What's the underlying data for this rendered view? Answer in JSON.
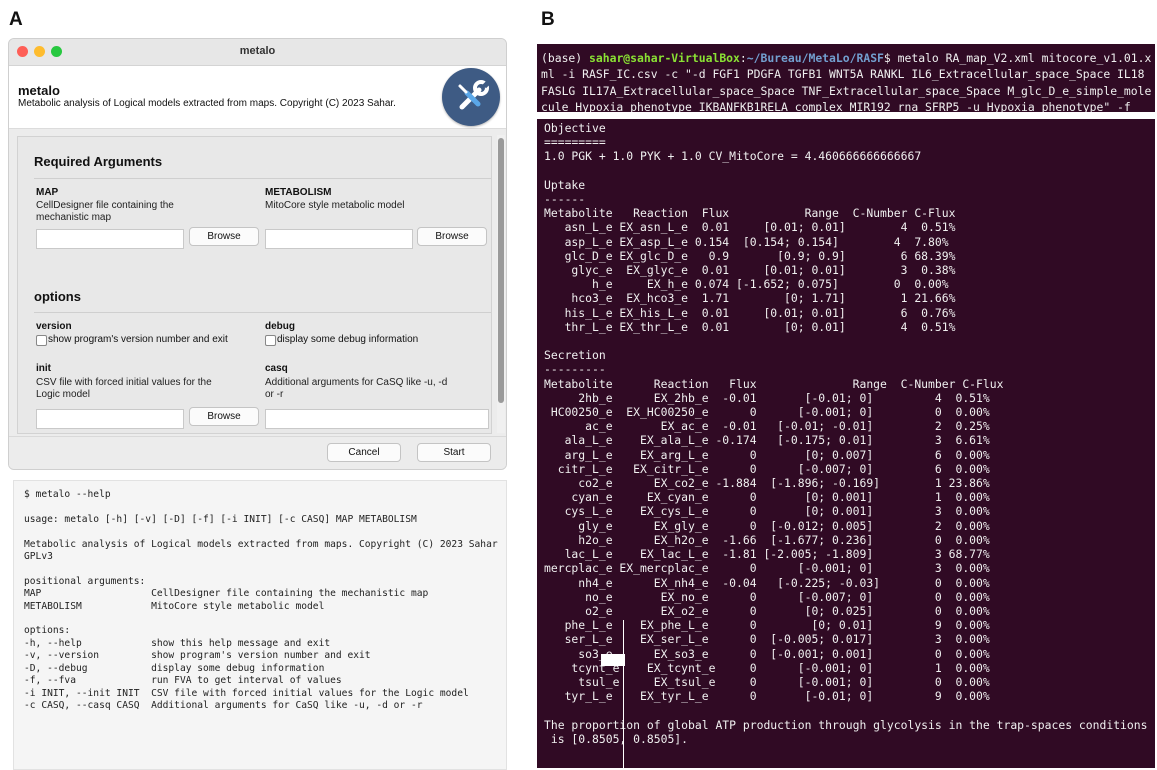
{
  "panels": {
    "a": "A",
    "b": "B"
  },
  "window": {
    "title": "metalo",
    "app_name": "metalo",
    "app_description": "Metabolic analysis of Logical models extracted from maps.  Copyright (C) 2023 Sahar.",
    "logo_icon": "tools-icon",
    "required_title": "Required Arguments",
    "map": {
      "label": "MAP",
      "desc_1": "CellDesigner file containing the",
      "desc_2": "mechanistic map",
      "browse": "Browse",
      "value": ""
    },
    "metabolism": {
      "label": "METABOLISM",
      "desc": "MitoCore style metabolic model",
      "browse": "Browse",
      "value": ""
    },
    "options_title": "options",
    "version": {
      "label": "version",
      "checkbox": "show program's version number and exit",
      "checked": false
    },
    "debug": {
      "label": "debug",
      "checkbox": "display some debug information",
      "checked": false
    },
    "init": {
      "label": "init",
      "desc_1": "CSV file with forced initial values for the",
      "desc_2": "Logic model",
      "browse": "Browse",
      "value": ""
    },
    "casq": {
      "label": "casq",
      "desc_1": "Additional arguments for CaSQ like -u, -d",
      "desc_2": "or -r",
      "value": ""
    },
    "cancel": "Cancel",
    "start": "Start"
  },
  "help_output": "$ metalo --help\n\nusage: metalo [-h] [-v] [-D] [-f] [-i INIT] [-c CASQ] MAP METABOLISM\n\nMetabolic analysis of Logical models extracted from maps. Copyright (C) 2023 Sahar\nGPLv3\n\npositional arguments:\nMAP                   CellDesigner file containing the mechanistic map\nMETABOLISM            MitoCore style metabolic model\n\noptions:\n-h, --help            show this help message and exit\n-v, --version         show program's version number and exit\n-D, --debug           display some debug information\n-f, --fva             run FVA to get interval of values\n-i INIT, --init INIT  CSV file with forced initial values for the Logic model\n-c CASQ, --casq CASQ  Additional arguments for CaSQ like -u, -d or -r",
  "command": {
    "env": "(base) ",
    "user_host": "sahar@sahar-VirtualBox",
    "sep": ":",
    "path": "~/Bureau/MetaLo/RASF",
    "cmd": "$ metalo RA_map_V2.xml mitocore_v1.01.x\nml -i RASF_IC.csv -c \"-d FGF1 PDGFA TGFB1 WNT5A RANKL IL6_Extracellular_space_Space IL18\nFASLG IL17A_Extracellular_space_Space TNF_Extracellular_space_Space M_glc_D_e_simple_mole\ncule Hypoxia_phenotype IKBANFKB1RELA_complex MIR192_rna SFRP5 -u Hypoxia_phenotype\" -f"
  },
  "output": "Objective\n=========\n1.0 PGK + 1.0 PYK + 1.0 CV_MitoCore = 4.460666666666667\n\nUptake\n------\nMetabolite   Reaction  Flux           Range  C-Number C-Flux\n   asn_L_e EX_asn_L_e  0.01     [0.01; 0.01]        4  0.51%\n   asp_L_e EX_asp_L_e 0.154  [0.154; 0.154]        4  7.80%\n   glc_D_e EX_glc_D_e   0.9       [0.9; 0.9]        6 68.39%\n    glyc_e  EX_glyc_e  0.01     [0.01; 0.01]        3  0.38%\n       h_e     EX_h_e 0.074 [-1.652; 0.075]        0  0.00%\n    hco3_e  EX_hco3_e  1.71        [0; 1.71]        1 21.66%\n   his_L_e EX_his_L_e  0.01     [0.01; 0.01]        6  0.76%\n   thr_L_e EX_thr_L_e  0.01        [0; 0.01]        4  0.51%\n\nSecretion\n---------\nMetabolite      Reaction   Flux              Range  C-Number C-Flux\n     2hb_e      EX_2hb_e  -0.01       [-0.01; 0]         4  0.51%\n HC00250_e  EX_HC00250_e      0      [-0.001; 0]         0  0.00%\n      ac_e       EX_ac_e  -0.01   [-0.01; -0.01]         2  0.25%\n   ala_L_e    EX_ala_L_e -0.174   [-0.175; 0.01]         3  6.61%\n   arg_L_e    EX_arg_L_e      0       [0; 0.007]         6  0.00%\n  citr_L_e   EX_citr_L_e      0      [-0.007; 0]         6  0.00%\n     co2_e      EX_co2_e -1.884  [-1.896; -0.169]        1 23.86%\n    cyan_e     EX_cyan_e      0       [0; 0.001]         1  0.00%\n   cys_L_e    EX_cys_L_e      0       [0; 0.001]         3  0.00%\n     gly_e      EX_gly_e      0  [-0.012; 0.005]         2  0.00%\n     h2o_e      EX_h2o_e  -1.66  [-1.677; 0.236]         0  0.00%\n   lac_L_e    EX_lac_L_e  -1.81 [-2.005; -1.809]         3 68.77%\nmercplac_e EX_mercplac_e      0      [-0.001; 0]         3  0.00%\n     nh4_e      EX_nh4_e  -0.04   [-0.225; -0.03]        0  0.00%\n      no_e       EX_no_e      0      [-0.007; 0]         0  0.00%\n      o2_e       EX_o2_e      0       [0; 0.025]         0  0.00%\n   phe_L_e    EX_phe_L_e      0        [0; 0.01]         9  0.00%\n   ser_L_e    EX_ser_L_e      0  [-0.005; 0.017]         3  0.00%\n     so3_e      EX_so3_e      0  [-0.001; 0.001]         0  0.00%\n    tcynt_e    EX_tcynt_e     0      [-0.001; 0]         1  0.00%\n     tsul_e     EX_tsul_e     0      [-0.001; 0]         0  0.00%\n   tyr_L_e    EX_tyr_L_e      0       [-0.01; 0]         9  0.00%\n\nThe proportion of global ATP production through glycolysis in the trap-spaces conditions\n is [0.8505, 0.8505]."
}
